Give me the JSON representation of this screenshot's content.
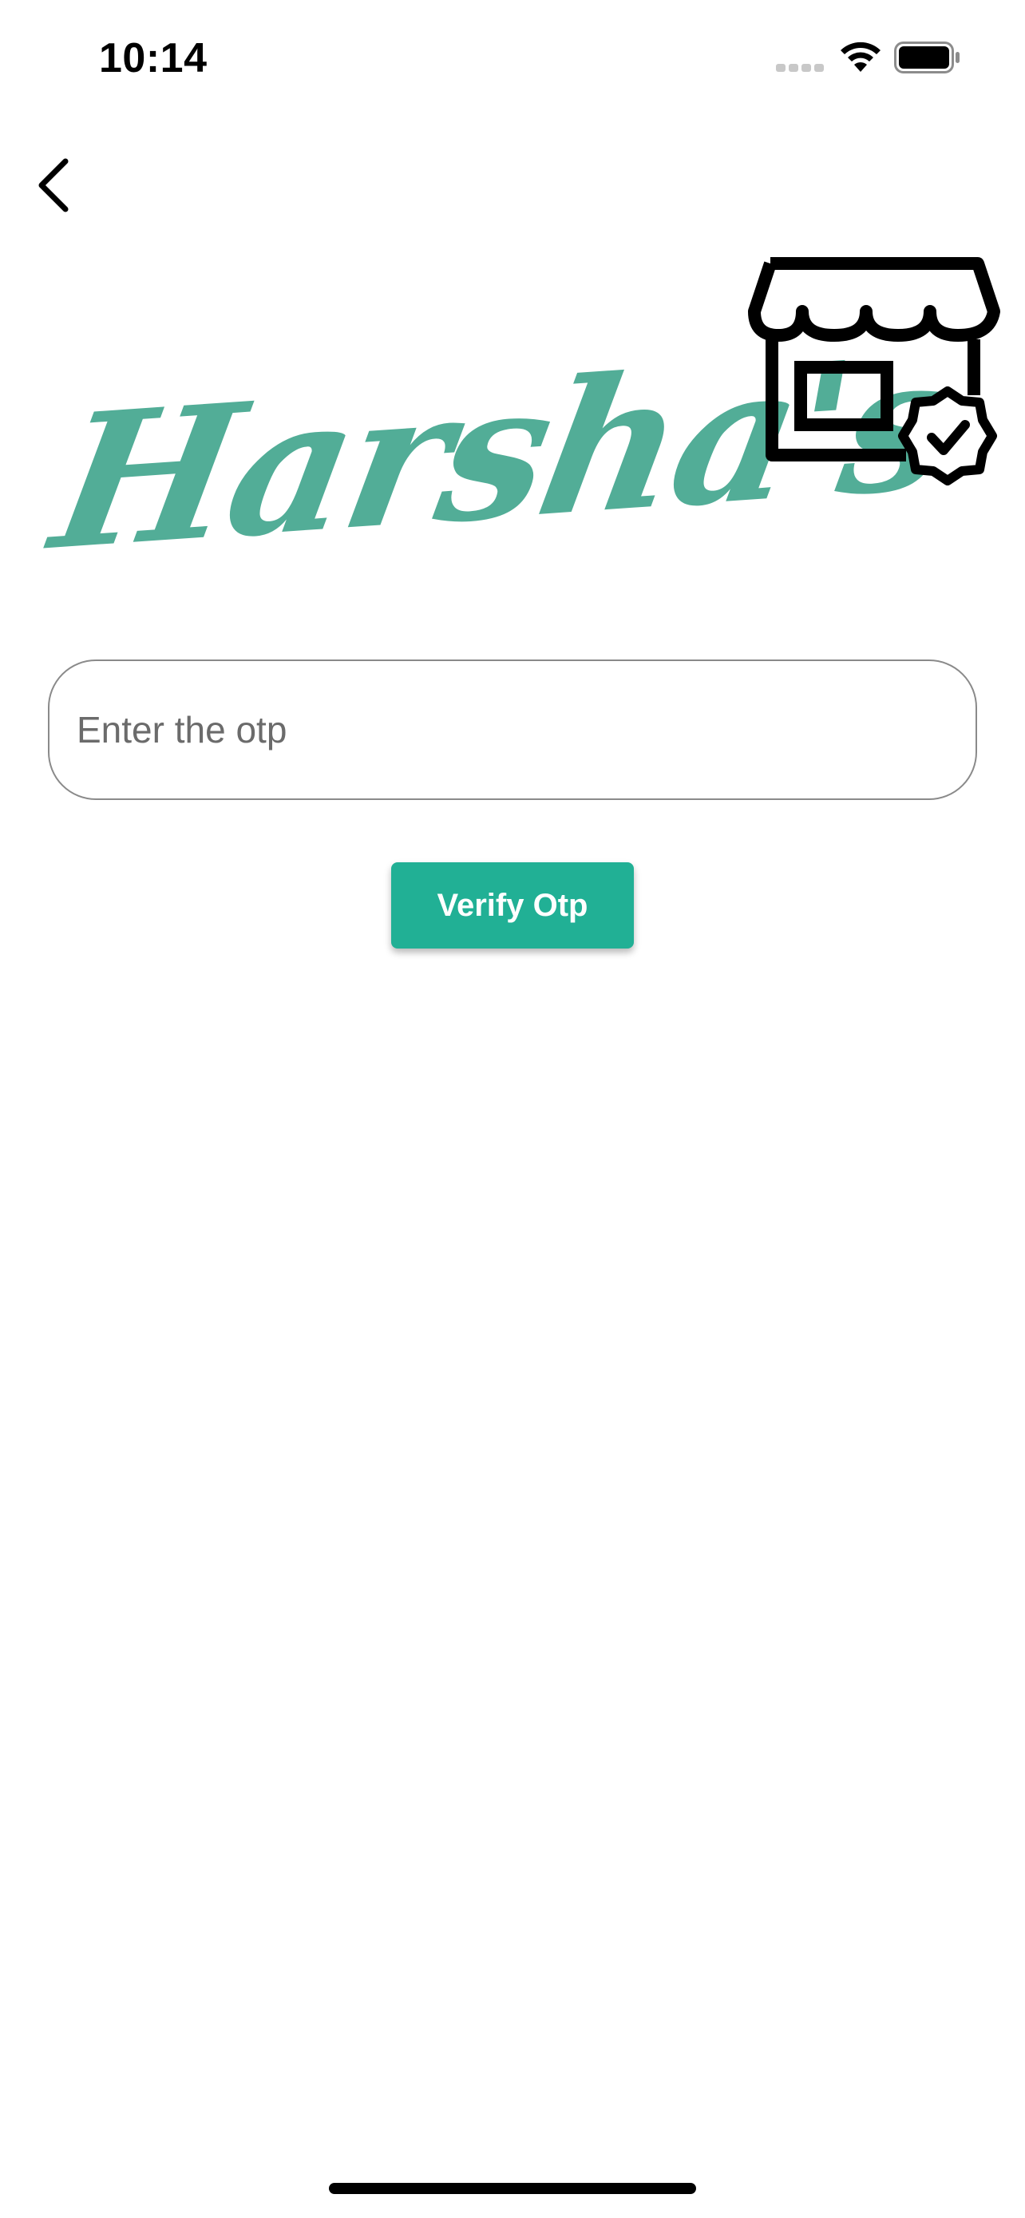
{
  "status_bar": {
    "time": "10:14",
    "icons": [
      "cellular-signal-icon",
      "wifi-icon",
      "battery-icon"
    ]
  },
  "nav": {
    "back_icon": "chevron-left-icon"
  },
  "logo": {
    "wordmark": "Harsha's",
    "icon": "store-verified-icon",
    "brand_color": "#52ad97"
  },
  "otp": {
    "value": "",
    "placeholder": "Enter the otp"
  },
  "verify_button": {
    "label": "Verify Otp",
    "color": "#21b095"
  }
}
